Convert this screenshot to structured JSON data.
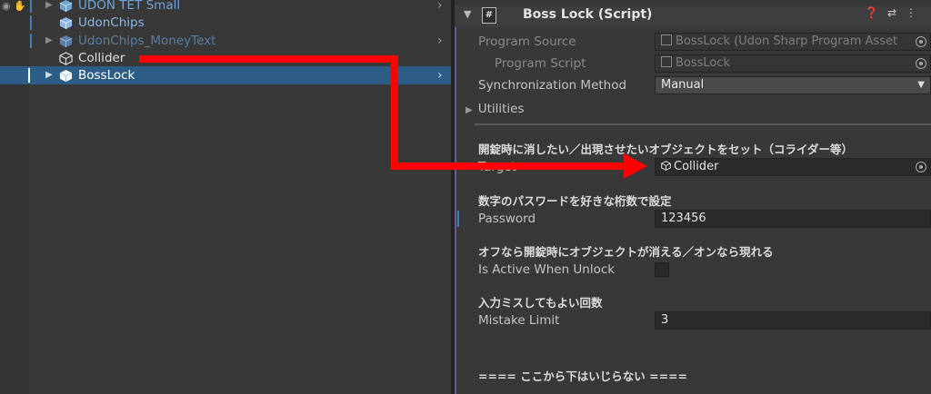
{
  "hierarchy": {
    "items": [
      {
        "name": "UDON TET Small",
        "color": "#6fa4d8",
        "has_children": true
      },
      {
        "name": "UdonChips",
        "color": "#8ab8e8",
        "has_children": false
      },
      {
        "name": "UdonChips_MoneyText",
        "color": "#5a7fa6",
        "has_children": true
      },
      {
        "name": "Collider",
        "color": "#e0e0e0",
        "has_children": false
      },
      {
        "name": "BossLock",
        "color": "#ffffff",
        "has_children": true,
        "selected": true
      }
    ]
  },
  "inspector": {
    "component_title": "Boss Lock (Script)",
    "program_source_label": "Program Source",
    "program_source_value": "BossLock (Udon Sharp Program Asset",
    "program_script_label": "Program Script",
    "program_script_value": "BossLock",
    "sync_label": "Synchronization Method",
    "sync_value": "Manual",
    "utilities_label": "Utilities",
    "section1_title": "開錠時に消したい／出現させたいオブジェクトをセット（コライダー等）",
    "target_label": "Target",
    "target_value": "Collider",
    "section2_title": "数字のパスワードを好きな桁数で設定",
    "password_label": "Password",
    "password_value": "123456",
    "section3_title": "オフなら開錠時にオブジェクトが消える／オンなら現れる",
    "active_label": "Is Active When Unlock",
    "active_value": false,
    "section4_title": "入力ミスしてもよい回数",
    "mistake_label": "Mistake Limit",
    "mistake_value": "3",
    "footer_text": "==== ここから下はいじらない ===="
  },
  "colors": {
    "annotation_arrow": "#ff0000",
    "selection": "#2c5d87",
    "panel_bg": "#383838"
  }
}
